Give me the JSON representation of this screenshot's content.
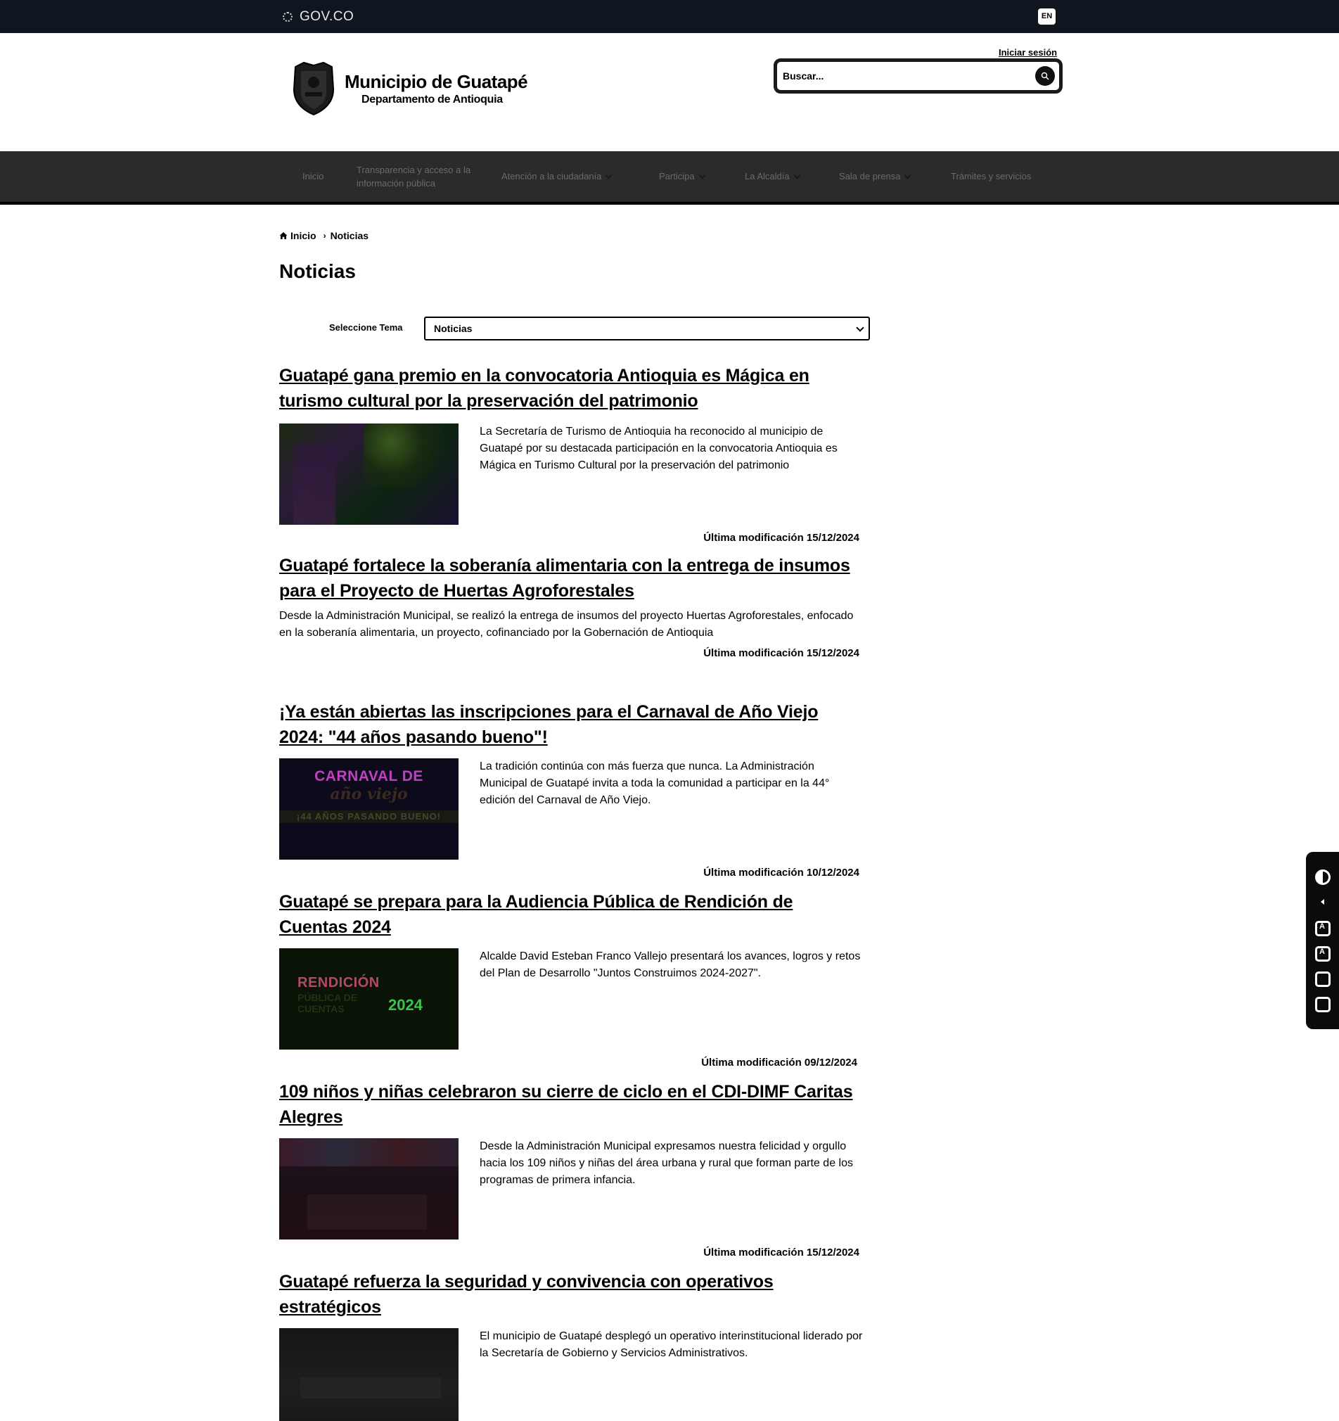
{
  "govbar": {
    "logo_text": "GOV.CO",
    "lang_button": "EN"
  },
  "header": {
    "title": "Municipio de Guatapé",
    "subtitle": "Departamento de Antioquia",
    "login_link": "Iniciar sesión",
    "search_placeholder": "Buscar..."
  },
  "nav": {
    "items": [
      {
        "label": "Inicio"
      },
      {
        "label": "Transparencia y acceso a la información pública"
      },
      {
        "label": "Atención a la ciudadanía"
      },
      {
        "label": "Participa"
      },
      {
        "label": "La Alcaldía"
      },
      {
        "label": "Sala de prensa"
      },
      {
        "label": "Trámites y servicios"
      }
    ]
  },
  "breadcrumb": {
    "home": "Inicio",
    "current": "Noticias"
  },
  "page_title": "Noticias",
  "filter": {
    "label": "Seleccione Tema",
    "selected": "Noticias"
  },
  "date_label": "Última modificación",
  "news": [
    {
      "title": "Guatapé gana premio en la convocatoria Antioquia es Mágica en turismo cultural por la preservación del patrimonio",
      "summary": "La Secretaría de Turismo de Antioquia ha reconocido al municipio de Guatapé por su destacada participación en la convocatoria Antioquia es Mágica en Turismo Cultural por la preservación del patrimonio",
      "date": "15/12/2024"
    },
    {
      "title": "Guatapé fortalece la soberanía alimentaria con la entrega de insumos para el Proyecto de Huertas Agroforestales",
      "summary": "Desde la Administración Municipal, se realizó la entrega de insumos del proyecto Huertas Agroforestales, enfocado en la soberanía alimentaria, un proyecto, cofinanciado por la Gobernación de Antioquia",
      "date": "15/12/2024"
    },
    {
      "title": "¡Ya están abiertas las inscripciones para el Carnaval de Año Viejo 2024: \"44 años pasando bueno\"!",
      "summary": "La tradición continúa con más fuerza que nunca. La Administración Municipal de Guatapé invita a toda la comunidad a participar en la 44° edición del Carnaval de Año Viejo.",
      "date": "10/12/2024",
      "thumb": {
        "line1": "CARNAVAL DE",
        "line2": "año viejo",
        "band": "¡44 AÑOS PASANDO BUENO!"
      }
    },
    {
      "title": "Guatapé se prepara para la Audiencia Pública de Rendición de Cuentas 2024",
      "summary": "Alcalde David Esteban Franco Vallejo presentará los avances, logros y retos del Plan de Desarrollo \"Juntos Construimos 2024-2027\".",
      "date": "09/12/2024",
      "thumb": {
        "line1": "RENDICIÓN",
        "line2": "PÚBLICA DE CUENTAS",
        "year": "2024"
      }
    },
    {
      "title": "109 niños y niñas celebraron su cierre de ciclo en el CDI-DIMF Caritas Alegres",
      "summary": "Desde la Administración Municipal expresamos nuestra felicidad y orgullo hacia los 109 niños y niñas del área urbana y rural que forman parte de los programas de primera infancia.",
      "date": "15/12/2024"
    },
    {
      "title": "Guatapé refuerza la seguridad y convivencia con operativos estratégicos",
      "summary": "El municipio de Guatapé desplegó un operativo interinstitucional liderado por la Secretaría de Gobierno y Servicios Administrativos."
    }
  ]
}
